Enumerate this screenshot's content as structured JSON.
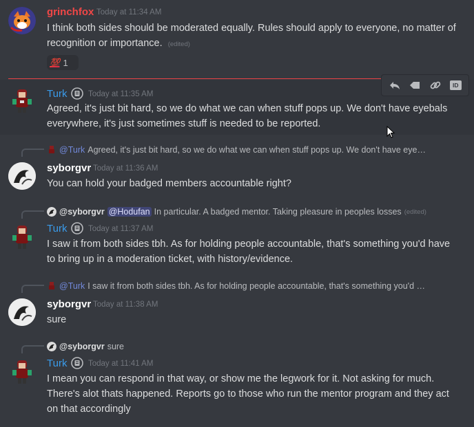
{
  "messages": [
    {
      "author": "grinchfox",
      "timestamp": "Today at 11:34 AM",
      "text": "I think both sides should be moderated equally. Rules should apply to everyone, no matter of recognition or importance.",
      "edited": "(edited)",
      "reaction": {
        "emoji": "💯",
        "count": "1"
      }
    },
    {
      "author": "Turk",
      "timestamp": "Today at 11:35 AM",
      "text": "Agreed, it's just bit hard, so we do what we can when stuff pops up. We don't have eyebals everywhere, it's just sometimes stuff is needed to be reported."
    },
    {
      "reply_to": "@Turk",
      "reply_preview": "Agreed, it's just bit hard, so we do what we can when stuff pops up. We don't have eye…",
      "author": "syborgvr",
      "timestamp": "Today at 11:36 AM",
      "text": "You can hold your badged members accountable right?"
    },
    {
      "reply_to": "@syborgvr",
      "reply_mention": "@Hodufan",
      "reply_preview": "In particular. A badged mentor. Taking pleasure in peoples losses",
      "reply_edited": "(edited)",
      "author": "Turk",
      "timestamp": "Today at 11:37 AM",
      "text": "I saw it from both sides tbh. As for holding people accountable, that's something you'd have to bring up in a moderation ticket, with history/evidence."
    },
    {
      "reply_to": "@Turk",
      "reply_preview": "I saw it from both sides tbh. As for holding people accountable, that's something you'd …",
      "author": "syborgvr",
      "timestamp": "Today at 11:38 AM",
      "text": "sure"
    },
    {
      "reply_to": "@syborgvr",
      "reply_preview": "sure",
      "author": "Turk",
      "timestamp": "Today at 11:41 AM",
      "text": "I mean you can respond in that way, or show me the legwork for it. Not asking for much. There's alot thats happened. Reports go to those who run the mentor program and they act on that accordingly"
    }
  ],
  "toolbar": {
    "icons": [
      "reply-icon",
      "tag-icon",
      "link-icon",
      "id-icon"
    ],
    "id_label": "ID"
  },
  "colors": {
    "background": "#36393f",
    "grinchfox": "#f04747",
    "turk": "#3a9bea",
    "new_divider": "#ed4245"
  }
}
